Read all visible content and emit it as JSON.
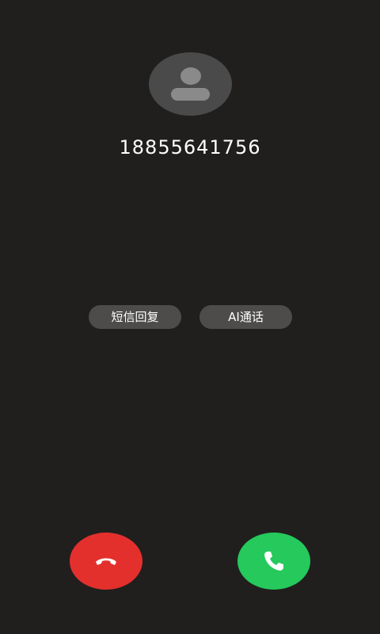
{
  "caller": {
    "number": "18855641756"
  },
  "quick_actions": {
    "sms_reply_label": "短信回复",
    "ai_call_label": "AI通话"
  },
  "icons": {
    "avatar": "person-avatar-icon",
    "decline": "phone-hangup-icon",
    "answer": "phone-answer-icon"
  },
  "colors": {
    "background": "#201f1e",
    "decline": "#e3302d",
    "answer": "#25c95c",
    "pill": "#4d4c4b"
  }
}
